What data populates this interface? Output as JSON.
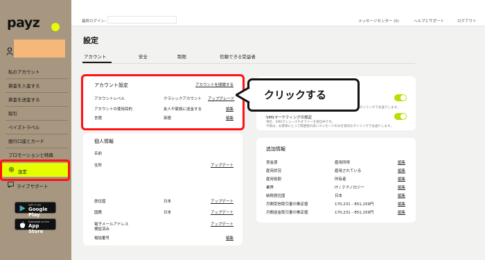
{
  "sidebar": {
    "logo": "payz",
    "items": [
      {
        "label": "私のアカウント"
      },
      {
        "label": "資金を入金する"
      },
      {
        "label": "資金を送金する"
      },
      {
        "label": "取引"
      },
      {
        "label": "ペイズトラベル"
      },
      {
        "label": "銀行口座とカード"
      },
      {
        "label": "プロモーションと特典"
      }
    ],
    "settings_label": "設定",
    "support_label": "ライブサポート",
    "google_play": {
      "small": "GET IT ON",
      "big": "Google Play"
    },
    "app_store": {
      "small": "Download on the",
      "big": "App Store"
    }
  },
  "topbar": {
    "last_login": "最終ログイン:",
    "message_center": "メッセージセンター (0)",
    "help": "ヘルプとサポート",
    "logout": "ログアウト"
  },
  "page": {
    "title": "設定",
    "tabs": [
      "アカウント",
      "安全",
      "制限",
      "信頼できる受益者"
    ]
  },
  "account_settings": {
    "title": "アカウント設定",
    "close_link": "アカウントを閉鎖する",
    "rows": [
      {
        "label": "アカウントレベル",
        "value": "クラシックアカウント",
        "action": "アップグレード"
      },
      {
        "label": "アカウントの使用目的",
        "value": "友人や家族に送金する",
        "action": "編集"
      },
      {
        "label": "言語",
        "value": "英語",
        "action": "編集"
      }
    ]
  },
  "personal_info": {
    "title": "個人情報",
    "rows": [
      {
        "label": "名前",
        "value": "",
        "action": ""
      },
      {
        "label": "住所",
        "value": "",
        "action": "アップデート"
      },
      {
        "label": "居住国",
        "value": "日本",
        "action": "アップデート"
      },
      {
        "label": "国籍",
        "value": "日本",
        "action": "アップデート"
      },
      {
        "label": "電子メールアドレス",
        "sub": "検証済み",
        "value": "",
        "action": "アップデート"
      },
      {
        "label": "電話番号",
        "value": "",
        "action": "編集"
      }
    ]
  },
  "marketing": {
    "row1_note": "タイミングでお送りします。",
    "sms_title": "SMSマーケティングの設定",
    "sms_note1": "現在、SMSでニュースやオファーを受信中です。",
    "sms_note2": "今後は、お客様にとって関連性の高いメッセージのみを適切なタイミングでお送りします。",
    "toggle1_on": true,
    "toggle2_on": true
  },
  "additional_info": {
    "title": "追加情報",
    "rows": [
      {
        "label": "資金源",
        "value": "雇用所得",
        "action": "編集"
      },
      {
        "label": "雇用状況",
        "value": "雇用されている",
        "action": "編集"
      },
      {
        "label": "雇用役割",
        "value": "所有者",
        "action": "編集"
      },
      {
        "label": "業界",
        "value": "IT / テクノロジー",
        "action": "編集"
      },
      {
        "label": "納税居住国",
        "value": "日本",
        "action": "編集"
      },
      {
        "label": "月間受信取引量の推定値",
        "value": "170,231 - 851,159円",
        "action": "編集"
      },
      {
        "label": "月間送金取引量の推定値",
        "value": "170,231 - 851,159円",
        "action": "編集"
      }
    ]
  },
  "callout": {
    "text": "クリックする"
  },
  "colors": {
    "accent": "#e5ff00",
    "highlight": "#ff1111",
    "sidebar": "#a79680",
    "toggle": "#b5e000"
  }
}
